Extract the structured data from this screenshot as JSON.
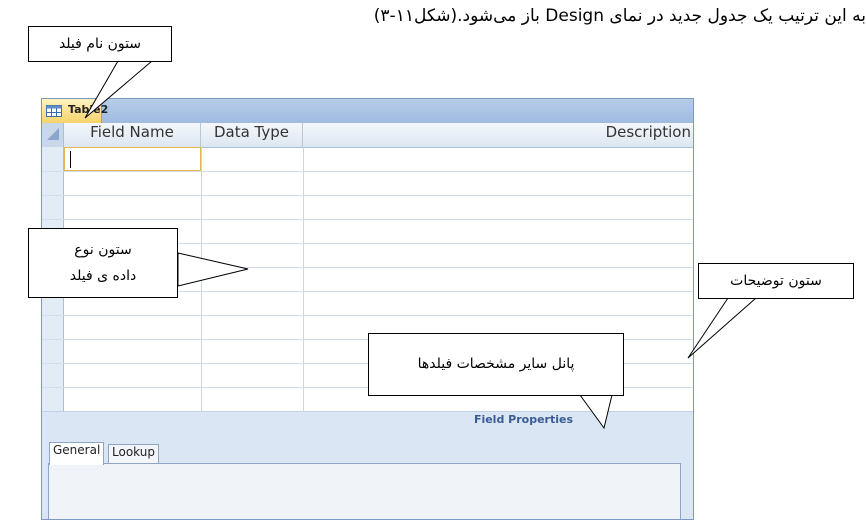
{
  "caption": "به این ترتیب یک جدول جدید در نمای Design باز می‌شود.(شکل۱۱-۳)",
  "window": {
    "tab_title": "Table2",
    "tab_icon": "table-icon",
    "columns": [
      "Field Name",
      "Data Type",
      "Description"
    ],
    "field_properties_label": "Field Properties",
    "property_tabs": [
      "General",
      "Lookup"
    ],
    "active_property_tab": "General",
    "accent_color": "#f6d36b",
    "frame_color": "#7d98c2"
  },
  "callouts": {
    "field_name": "ستون نام فیلد",
    "data_type_line1": "ستون نوع",
    "data_type_line2": "داده ی  فیلد",
    "description": "ستون توضیحات",
    "properties_panel": "پانل سایر مشخصات فیلدها"
  }
}
